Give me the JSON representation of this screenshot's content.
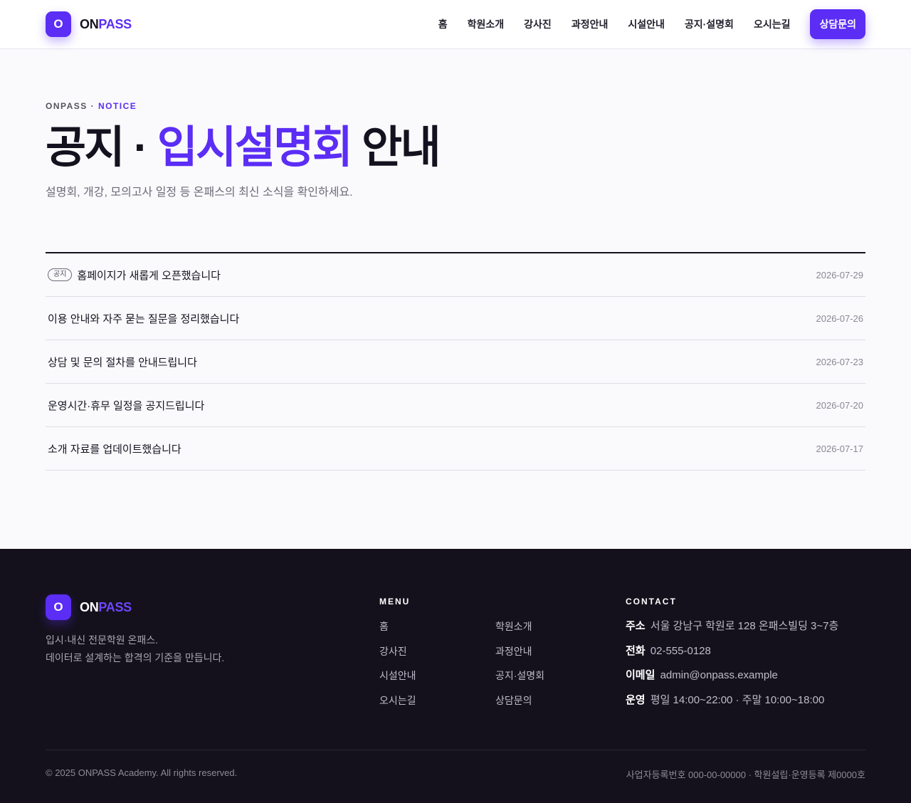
{
  "header": {
    "logo_mark": "O",
    "brand_on": "ON",
    "brand_pass": "PASS",
    "nav": [
      "홈",
      "학원소개",
      "강사진",
      "과정안내",
      "시설안내",
      "공지·설명회",
      "오시는길"
    ],
    "cta": "상담문의"
  },
  "hero": {
    "eyebrow_prefix": "ONPASS · ",
    "eyebrow_accent": "NOTICE",
    "title_part1": "공지 · ",
    "title_highlight": "입시설명회",
    "title_part2": " 안내",
    "subtitle": "설명회, 개강, 모의고사 일정 등 온패스의 최신 소식을 확인하세요."
  },
  "notices": [
    {
      "badge": "공지",
      "title": "홈페이지가 새롭게 오픈했습니다",
      "date": "2026-07-29"
    },
    {
      "badge": "",
      "title": "이용 안내와 자주 묻는 질문을 정리했습니다",
      "date": "2026-07-26"
    },
    {
      "badge": "",
      "title": "상담 및 문의 절차를 안내드립니다",
      "date": "2026-07-23"
    },
    {
      "badge": "",
      "title": "운영시간·휴무 일정을 공지드립니다",
      "date": "2026-07-20"
    },
    {
      "badge": "",
      "title": "소개 자료를 업데이트했습니다",
      "date": "2026-07-17"
    }
  ],
  "footer": {
    "logo_mark": "O",
    "brand_on": "ON",
    "brand_pass": "PASS",
    "desc_line1": "입시·내신 전문학원 온패스.",
    "desc_line2": "데이터로 설계하는 합격의 기준을 만듭니다.",
    "menu_heading": "MENU",
    "menu_links": [
      "홈",
      "학원소개",
      "강사진",
      "과정안내",
      "시설안내",
      "공지·설명회",
      "오시는길",
      "상담문의"
    ],
    "contact_heading": "CONTACT",
    "contact": [
      {
        "key": "주소",
        "value": "서울 강남구 학원로 128 온패스빌딩 3~7층"
      },
      {
        "key": "전화",
        "value": "02-555-0128"
      },
      {
        "key": "이메일",
        "value": "admin@onpass.example"
      },
      {
        "key": "운영",
        "value": "평일 14:00~22:00 · 주말 10:00~18:00"
      }
    ],
    "copyright": "© 2025 ONPASS Academy. All rights reserved.",
    "bizinfo": "사업자등록번호 000-00-00000 · 학원설립·운영등록 제0000호"
  },
  "colors": {
    "accent": "#5b2df5",
    "footer_bg": "#14111c",
    "page_bg": "#fafafc"
  }
}
